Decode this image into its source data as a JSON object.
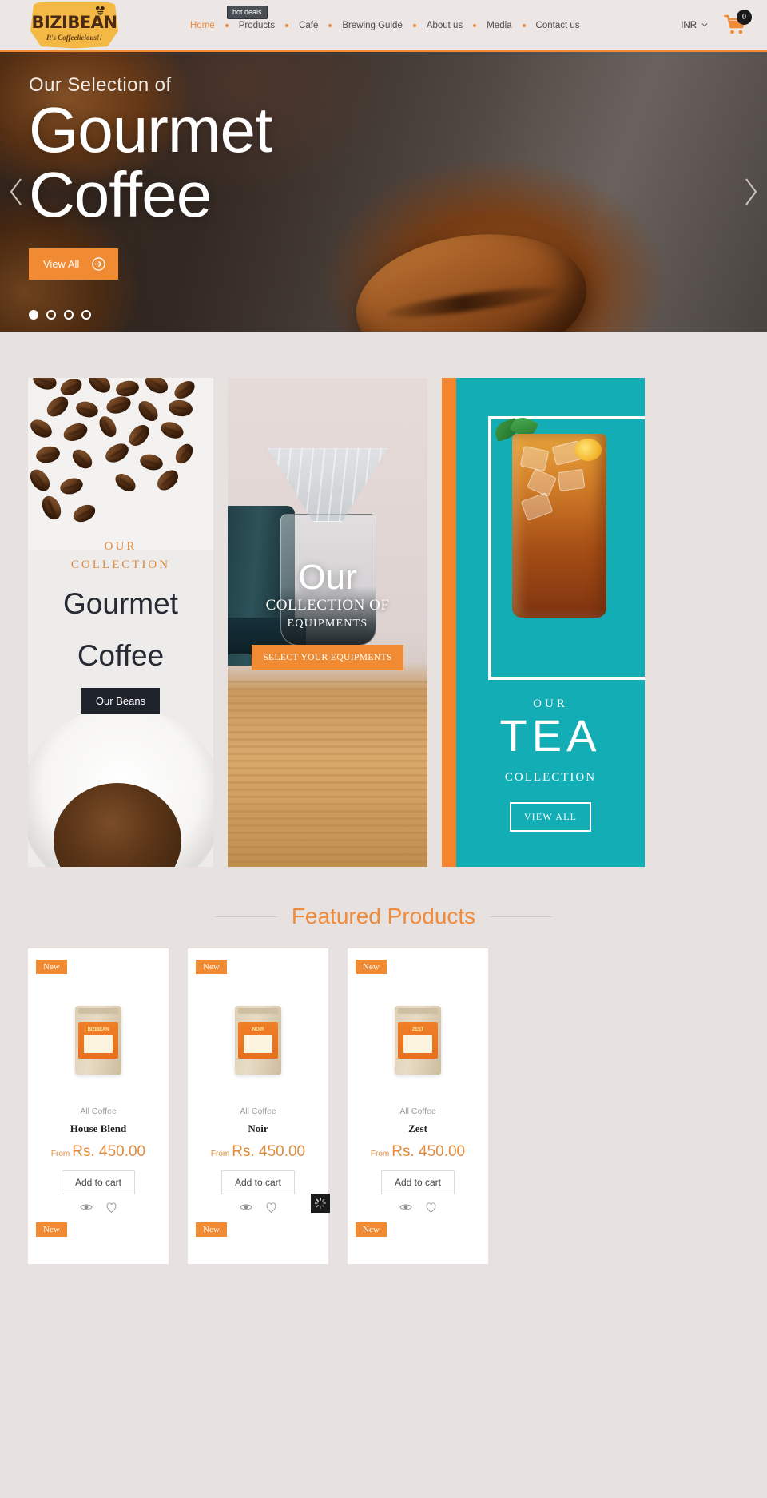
{
  "header": {
    "logo": {
      "name": "BIZIBEAN",
      "tagline": "It's Coffeelicious!!"
    },
    "nav": [
      {
        "label": "Home",
        "active": true
      },
      {
        "label": "Products",
        "active": false,
        "tooltip": "hot deals"
      },
      {
        "label": "Cafe",
        "active": false
      },
      {
        "label": "Brewing Guide",
        "active": false
      },
      {
        "label": "About us",
        "active": false
      },
      {
        "label": "Media",
        "active": false
      },
      {
        "label": "Contact us",
        "active": false
      }
    ],
    "currency": "INR",
    "cart_count": "0"
  },
  "hero": {
    "subtitle": "Our Selection of",
    "title_line1": "Gourmet",
    "title_line2": "Coffee",
    "cta": "View All",
    "slide_count": 4,
    "active_slide": 1
  },
  "collections": {
    "coffee": {
      "eyebrow_line1": "OUR",
      "eyebrow_line2": "COLLECTION",
      "title_line1": "Gourmet",
      "title_line2": "Coffee",
      "button": "Our Beans"
    },
    "equipment": {
      "title": "Our",
      "sub1": "COLLECTION OF",
      "sub2": "EQUIPMENTS",
      "button": "SELECT YOUR EQUIPMENTS"
    },
    "tea": {
      "eyebrow": "OUR",
      "title": "TEA",
      "sub": "COLLECTION",
      "button": "VIEW ALL"
    }
  },
  "featured": {
    "title": "Featured Products",
    "products": [
      {
        "badge": "New",
        "category": "All Coffee",
        "name": "House Blend",
        "price_from": "From",
        "price": "Rs. 450.00",
        "add_to_cart": "Add to cart",
        "bag_label": "BIZIBEAN",
        "row2_badge": "New"
      },
      {
        "badge": "New",
        "category": "All Coffee",
        "name": "Noir",
        "price_from": "From",
        "price": "Rs. 450.00",
        "add_to_cart": "Add to cart",
        "bag_label": "NOIR",
        "row2_badge": "New"
      },
      {
        "badge": "New",
        "category": "All Coffee",
        "name": "Zest",
        "price_from": "From",
        "price": "Rs. 450.00",
        "add_to_cart": "Add to cart",
        "bag_label": "ZEST",
        "row2_badge": "New"
      }
    ]
  },
  "colors": {
    "accent_orange": "#f08a33",
    "teal": "#13adb6",
    "page_bg": "#e7e2e0",
    "header_bg": "#ece6e4",
    "dark": "#1f232b"
  }
}
